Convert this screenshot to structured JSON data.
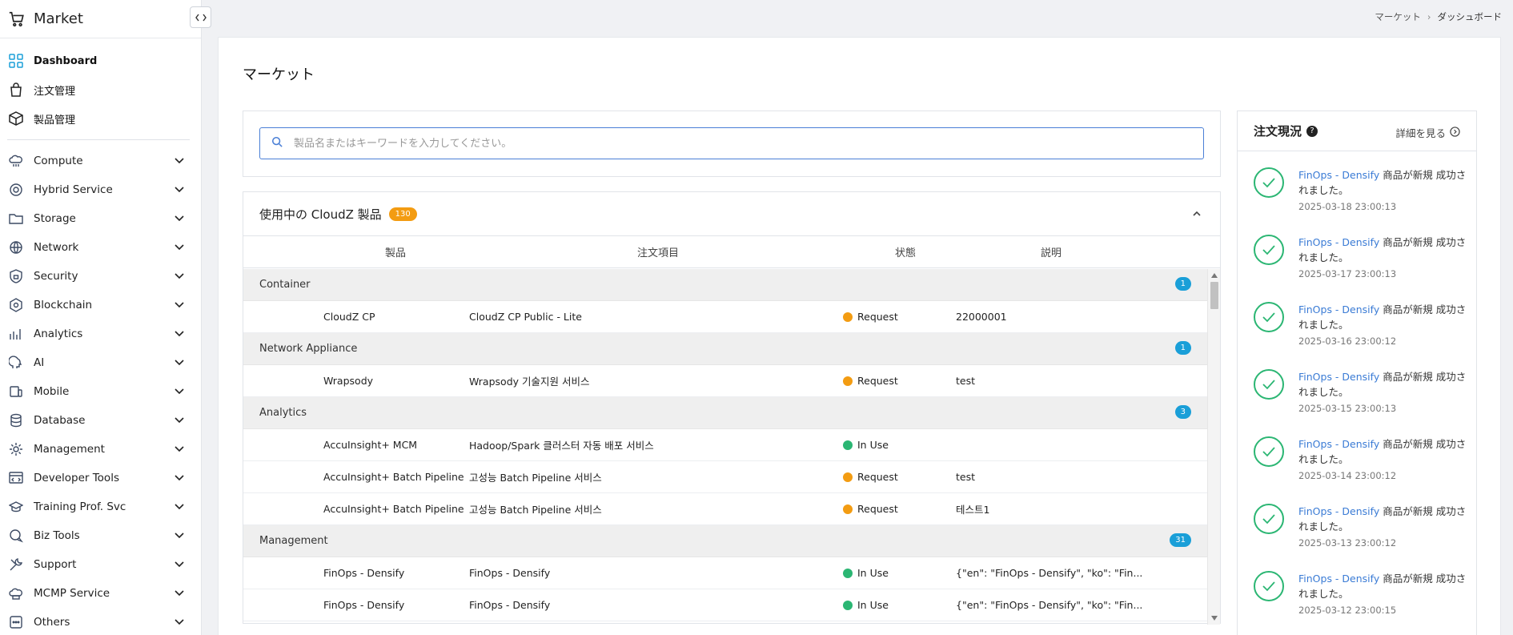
{
  "app": {
    "title": "Market"
  },
  "breadcrumb": [
    "マーケット",
    "ダッシュボード"
  ],
  "sidebar": {
    "top_items": [
      {
        "label": "Dashboard",
        "icon": "dashboard-grid-icon",
        "active": true
      },
      {
        "label": "注文管理",
        "icon": "shopping-bag-icon"
      },
      {
        "label": "製品管理",
        "icon": "box-icon"
      }
    ],
    "menu": [
      {
        "label": "Compute",
        "icon": "cloud-compute-icon"
      },
      {
        "label": "Hybrid Service",
        "icon": "hybrid-service-icon"
      },
      {
        "label": "Storage",
        "icon": "storage-folder-icon"
      },
      {
        "label": "Network",
        "icon": "network-icon"
      },
      {
        "label": "Security",
        "icon": "shield-lock-icon"
      },
      {
        "label": "Blockchain",
        "icon": "blockchain-icon"
      },
      {
        "label": "Analytics",
        "icon": "analytics-bars-icon"
      },
      {
        "label": "AI",
        "icon": "ai-head-icon"
      },
      {
        "label": "Mobile",
        "icon": "mobile-icon"
      },
      {
        "label": "Database",
        "icon": "database-icon"
      },
      {
        "label": "Management",
        "icon": "management-gear-icon"
      },
      {
        "label": "Developer Tools",
        "icon": "developer-tools-icon"
      },
      {
        "label": "Training Prof. Svc",
        "icon": "graduation-cap-icon"
      },
      {
        "label": "Biz Tools",
        "icon": "biz-chat-icon"
      },
      {
        "label": "Support",
        "icon": "wrench-tools-icon"
      },
      {
        "label": "MCMP Service",
        "icon": "mcmp-cloud-icon"
      },
      {
        "label": "Others",
        "icon": "others-icon"
      }
    ]
  },
  "main": {
    "title": "マーケット",
    "search": {
      "placeholder": "製品名またはキーワードを入力してください。",
      "value": ""
    },
    "products": {
      "title": "使用中の CloudZ 製品",
      "count": "130",
      "columns": [
        "製品",
        "注文項目",
        "状態",
        "説明"
      ],
      "groups": [
        {
          "name": "Container",
          "count": "1",
          "rows": [
            {
              "product": "CloudZ CP",
              "item": "CloudZ CP Public - Lite",
              "status": "Request",
              "status_color": "#f39c12",
              "desc": "22000001"
            }
          ]
        },
        {
          "name": "Network Appliance",
          "count": "1",
          "rows": [
            {
              "product": "Wrapsody",
              "item": "Wrapsody 기술지원 서비스",
              "status": "Request",
              "status_color": "#f39c12",
              "desc": "test"
            }
          ]
        },
        {
          "name": "Analytics",
          "count": "3",
          "rows": [
            {
              "product": "AccuInsight+ MCM",
              "item": "Hadoop/Spark 클러스터 자동 배포 서비스",
              "status": "In Use",
              "status_color": "#2bb673",
              "desc": ""
            },
            {
              "product": "AccuInsight+ Batch Pipeline",
              "item": "고성능 Batch Pipeline 서비스",
              "status": "Request",
              "status_color": "#f39c12",
              "desc": "test"
            },
            {
              "product": "AccuInsight+ Batch Pipeline",
              "item": "고성능 Batch Pipeline 서비스",
              "status": "Request",
              "status_color": "#f39c12",
              "desc": "테스트1"
            }
          ]
        },
        {
          "name": "Management",
          "count": "31",
          "rows": [
            {
              "product": "FinOps - Densify",
              "item": "FinOps - Densify",
              "status": "In Use",
              "status_color": "#2bb673",
              "desc": "{\"en\": \"FinOps - Densify\", \"ko\": \"Fin..."
            },
            {
              "product": "FinOps - Densify",
              "item": "FinOps - Densify",
              "status": "In Use",
              "status_color": "#2bb673",
              "desc": "{\"en\": \"FinOps - Densify\", \"ko\": \"Fin..."
            }
          ]
        }
      ]
    },
    "order_status": {
      "title": "注文現況",
      "detail_label": "詳細を見る",
      "feed": [
        {
          "product": "FinOps - Densify",
          "message": "商品が新規 成功されました。",
          "time": "2025-03-18 23:00:13"
        },
        {
          "product": "FinOps - Densify",
          "message": "商品が新規 成功されました。",
          "time": "2025-03-17 23:00:13"
        },
        {
          "product": "FinOps - Densify",
          "message": "商品が新規 成功されました。",
          "time": "2025-03-16 23:00:12"
        },
        {
          "product": "FinOps - Densify",
          "message": "商品が新規 成功されました。",
          "time": "2025-03-15 23:00:13"
        },
        {
          "product": "FinOps - Densify",
          "message": "商品が新規 成功されました。",
          "time": "2025-03-14 23:00:12"
        },
        {
          "product": "FinOps - Densify",
          "message": "商品が新規 成功されました。",
          "time": "2025-03-13 23:00:12"
        },
        {
          "product": "FinOps - Densify",
          "message": "商品が新規 成功されました。",
          "time": "2025-03-12 23:00:15"
        }
      ]
    }
  }
}
